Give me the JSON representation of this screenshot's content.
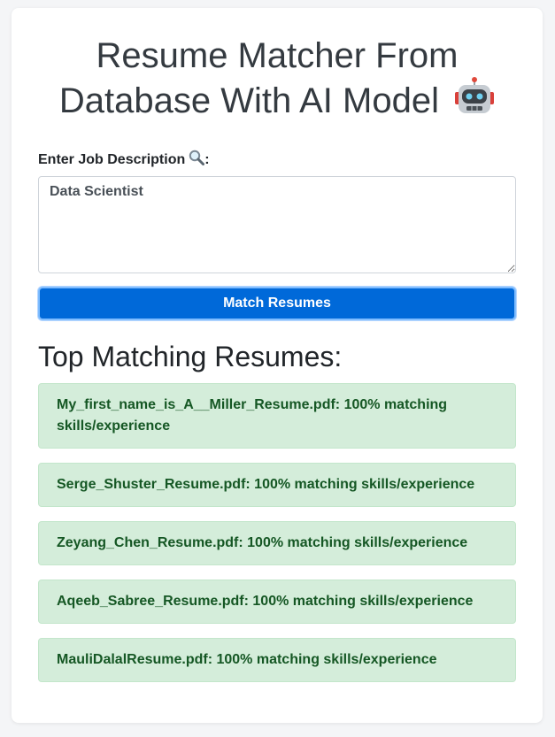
{
  "app": {
    "title_line1": "Resume Matcher From",
    "title_line2": "Database With AI Model"
  },
  "form": {
    "label": "Enter Job Description",
    "job_description_value": "Data Scientist",
    "submit_label": "Match Resumes"
  },
  "results": {
    "heading": "Top Matching Resumes:",
    "items": [
      "My_first_name_is_A__Miller_Resume.pdf: 100% matching skills/experience",
      "Serge_Shuster_Resume.pdf: 100% matching skills/experience",
      "Zeyang_Chen_Resume.pdf: 100% matching skills/experience",
      "Aqeeb_Sabree_Resume.pdf: 100% matching skills/experience",
      "MauliDalalResume.pdf: 100% matching skills/experience"
    ]
  },
  "icons": {
    "title_icon": "robot-icon",
    "label_icon": "magnifying-glass-icon"
  },
  "colors": {
    "primary_button": "#0069d9",
    "success_bg": "#d4edda",
    "success_text": "#155724"
  }
}
